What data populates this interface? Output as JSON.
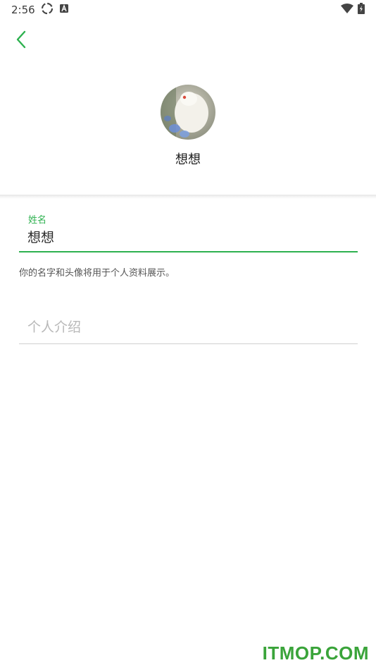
{
  "status_bar": {
    "time": "2:56",
    "icons": [
      "sync-icon",
      "font-icon",
      "wifi-icon",
      "battery-icon"
    ]
  },
  "header": {
    "back_icon": "chevron-left-icon",
    "accent_color": "#2db14f"
  },
  "profile": {
    "name": "想想"
  },
  "form": {
    "name_field": {
      "label": "姓名",
      "value": "想想"
    },
    "helper_text": "你的名字和头像将用于个人资料展示。",
    "intro_field": {
      "placeholder": "个人介绍",
      "value": ""
    }
  },
  "watermark": {
    "text": "ITMOP.COM",
    "color": "#3aa43a"
  }
}
